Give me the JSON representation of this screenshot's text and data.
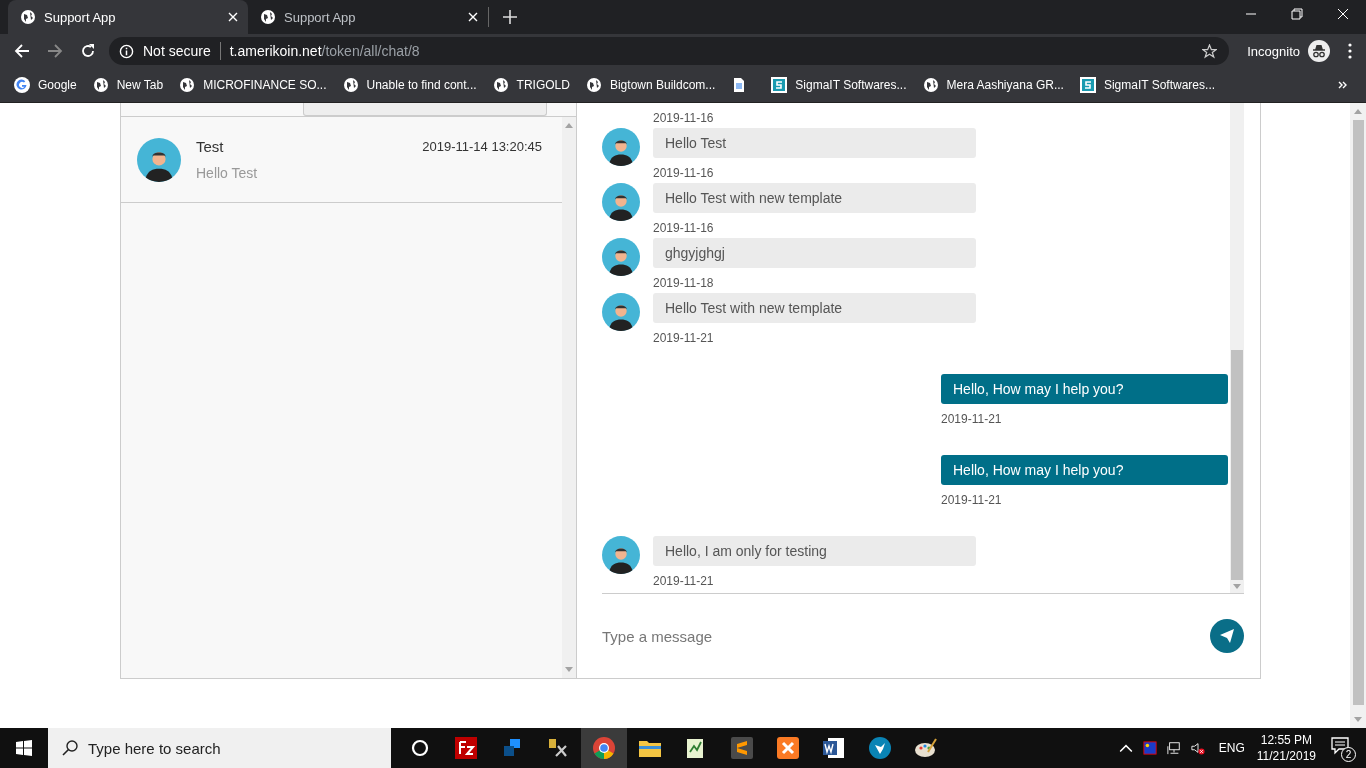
{
  "browser": {
    "tabs": [
      {
        "title": "Support App",
        "selected": true
      },
      {
        "title": "Support App",
        "selected": false
      }
    ],
    "address": {
      "security": "Not secure",
      "host": "t.amerikoin.net",
      "path": "/token/all/chat/8"
    },
    "profile": "Incognito",
    "bookmarks": [
      {
        "label": "Google",
        "kind": "google"
      },
      {
        "label": "New Tab",
        "kind": "globe"
      },
      {
        "label": "MICROFINANCE SO...",
        "kind": "globe"
      },
      {
        "label": "Unable to find cont...",
        "kind": "globe"
      },
      {
        "label": "TRIGOLD",
        "kind": "globe"
      },
      {
        "label": "Bigtown Buildcom...",
        "kind": "globe"
      },
      {
        "kind": "doc"
      },
      {
        "label": "SigmaIT Softwares...",
        "kind": "sigma"
      },
      {
        "label": "Mera Aashiyana GR...",
        "kind": "globe"
      },
      {
        "label": "SigmaIT Softwares...",
        "kind": "sigma"
      }
    ]
  },
  "contacts": [
    {
      "name": "Test",
      "time": "2019-11-14 13:20:45",
      "preview": "Hello Test"
    }
  ],
  "chat": {
    "top_date": "2019-11-16",
    "messages": [
      {
        "kind": "received",
        "text": "Hello Test",
        "date": "2019-11-16"
      },
      {
        "kind": "received",
        "text": "Hello Test with new template",
        "date": "2019-11-16"
      },
      {
        "kind": "received",
        "text": "ghgyjghgj",
        "date": "2019-11-18"
      },
      {
        "kind": "received",
        "text": "Hello Test with new template",
        "date": "2019-11-21"
      },
      {
        "kind": "sent",
        "text": "Hello, How may I help you?",
        "date": "2019-11-21"
      },
      {
        "kind": "sent",
        "text": "Hello, How may I help you?",
        "date": "2019-11-21"
      },
      {
        "kind": "received",
        "text": "Hello, I am only for testing",
        "date": "2019-11-21"
      }
    ],
    "composer": {
      "placeholder": "Type a message"
    }
  },
  "taskbar": {
    "search_placeholder": "Type here to search",
    "language": "ENG",
    "time": "12:55 PM",
    "date": "11/21/2019",
    "notifications": "2"
  }
}
